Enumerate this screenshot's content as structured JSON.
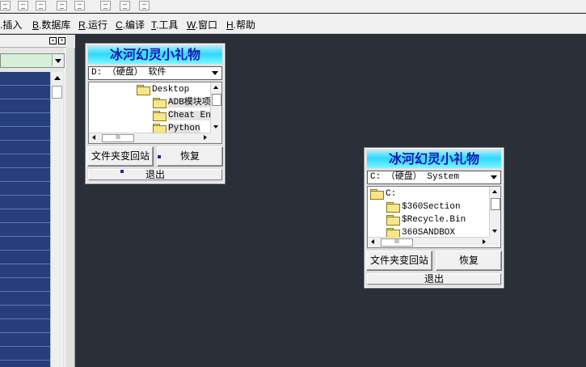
{
  "menubar": {
    "items": [
      {
        "key": "I",
        "label": ".插入"
      },
      {
        "key": "B",
        "label": ".数据库"
      },
      {
        "key": "R",
        "label": ".运行"
      },
      {
        "key": "C",
        "label": ".编译"
      },
      {
        "key": "T",
        "label": ".工具"
      },
      {
        "key": "W",
        "label": ".窗口"
      },
      {
        "key": "H",
        "label": ".帮助"
      }
    ]
  },
  "left_panel": {
    "pin_button": "▪",
    "close_button": "×"
  },
  "gift1": {
    "title": "冰河幻灵小礼物",
    "drive": "D: （硬盘） 软件",
    "folders": [
      {
        "label": "Desktop"
      },
      {
        "label": "ADB模块项"
      },
      {
        "label": "Cheat Eng"
      },
      {
        "label": "Python"
      }
    ],
    "recycle_button": "文件夹变回站",
    "restore_button": "恢复",
    "exit_button": "退出",
    "hscroll_grip": "III"
  },
  "gift2": {
    "title": "冰河幻灵小礼物",
    "drive": "C: （硬盘） System",
    "folders": [
      {
        "label": "C:"
      },
      {
        "label": "$360Section"
      },
      {
        "label": "$Recycle.Bin"
      },
      {
        "label": "360SANDBOX"
      }
    ],
    "recycle_button": "文件夹变回站",
    "restore_button": "恢复",
    "exit_button": "退出",
    "hscroll_grip": "III"
  }
}
